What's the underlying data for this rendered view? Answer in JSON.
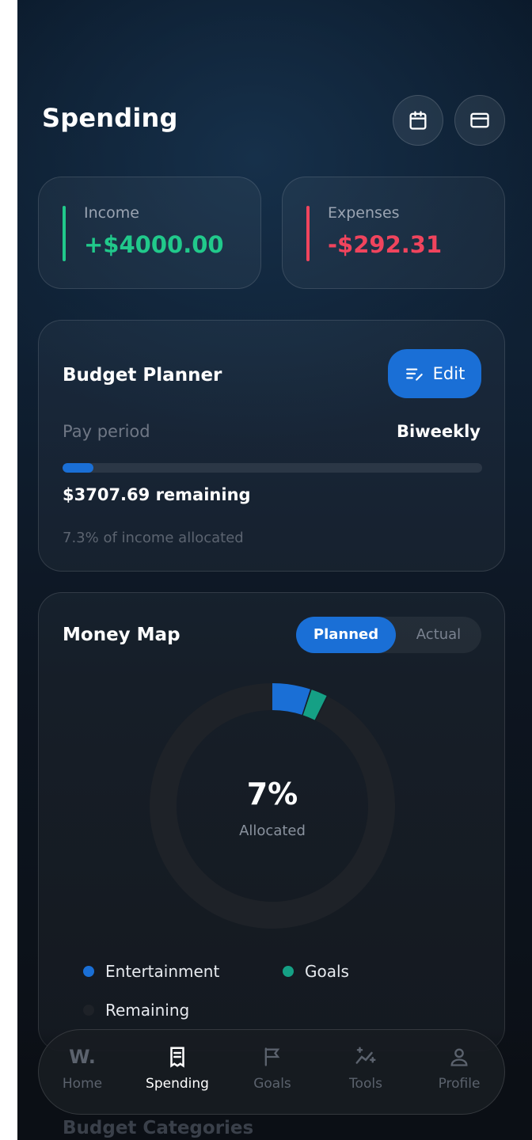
{
  "header": {
    "title": "Spending"
  },
  "stats": {
    "income": {
      "label": "Income",
      "value": "+$4000.00",
      "color": "#21c98b"
    },
    "expenses": {
      "label": "Expenses",
      "value": "-$292.31",
      "color": "#f0445d"
    }
  },
  "budget_planner": {
    "title": "Budget Planner",
    "edit_label": "Edit",
    "pay_period_label": "Pay period",
    "pay_period_value": "Biweekly",
    "remaining": "$3707.69 remaining",
    "allocated_note": "7.3% of income allocated",
    "progress_fraction": 0.073
  },
  "money_map": {
    "title": "Money Map",
    "toggle": {
      "planned": "Planned",
      "actual": "Actual",
      "selected": "Planned"
    },
    "center_value": "7%",
    "center_label": "Allocated",
    "legend": [
      {
        "label": "Entertainment",
        "color": "#1a6fd6"
      },
      {
        "label": "Goals",
        "color": "#15a085"
      },
      {
        "label": "Remaining",
        "color": "#1e2228"
      }
    ]
  },
  "chart_data": {
    "type": "pie",
    "segments": [
      {
        "label": "Entertainment",
        "percent": 5.0,
        "color": "#1a6fd6"
      },
      {
        "label": "Goals",
        "percent": 2.3,
        "color": "#15a085"
      },
      {
        "label": "Remaining",
        "percent": 92.7,
        "color": "#1e2228"
      }
    ]
  },
  "next_section": {
    "title": "Budget Categories"
  },
  "nav": {
    "items": [
      {
        "label": "Home",
        "icon": "w-logo-icon",
        "logo": "W."
      },
      {
        "label": "Spending",
        "icon": "receipt-icon"
      },
      {
        "label": "Goals",
        "icon": "flag-icon"
      },
      {
        "label": "Tools",
        "icon": "sparkle-chart-icon"
      },
      {
        "label": "Profile",
        "icon": "user-icon"
      }
    ],
    "active": "Spending"
  },
  "colors": {
    "accent": "#1a6fd6",
    "income": "#21c98b",
    "expense": "#f0445d",
    "goal": "#15a085"
  }
}
